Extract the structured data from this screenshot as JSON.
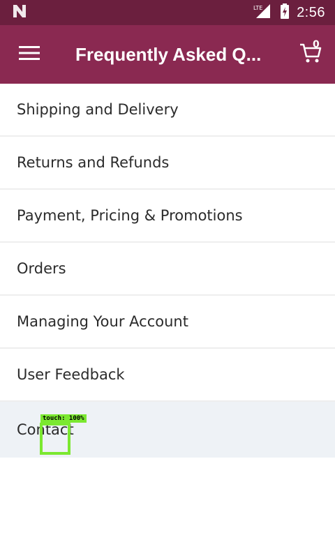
{
  "status_bar": {
    "time": "2:56",
    "network_label": "LTE"
  },
  "app_bar": {
    "title": "Frequently Asked Q...",
    "cart_count": "0"
  },
  "faq_items": [
    {
      "label": "Shipping and Delivery"
    },
    {
      "label": "Returns and Refunds"
    },
    {
      "label": "Payment, Pricing & Promotions"
    },
    {
      "label": "Orders"
    },
    {
      "label": "Managing Your Account"
    },
    {
      "label": "User Feedback"
    },
    {
      "label": "Contact"
    }
  ],
  "touch_overlay": {
    "label": "touch: 100%"
  },
  "colors": {
    "status_bar": "#6b1f3e",
    "app_bar": "#8a2951",
    "pressed_row": "#eef2f6",
    "touch_indicator": "#7be830"
  }
}
